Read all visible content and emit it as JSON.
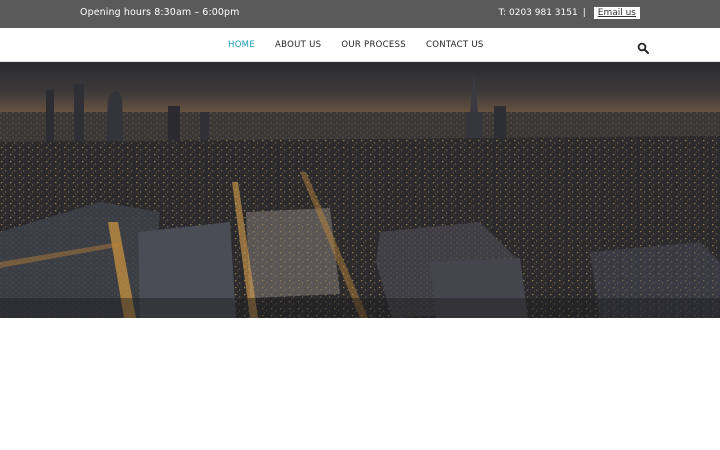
{
  "topbar": {
    "hours": "Opening hours 8:30am – 6:00pm",
    "phone": "T: 0203 981 3151",
    "separator": "|",
    "email_label": "Email us"
  },
  "nav": {
    "items": [
      {
        "label": "HOME",
        "active": true
      },
      {
        "label": "ABOUT US",
        "active": false
      },
      {
        "label": "OUR PROCESS",
        "active": false
      },
      {
        "label": "CONTACT US",
        "active": false
      }
    ],
    "search_icon": "search-icon"
  },
  "hero": {
    "image": "city-skyline-at-dusk"
  },
  "colors": {
    "topbar_bg": "#5a5a5a",
    "accent": "#1a9bb6",
    "nav_text": "#222222"
  }
}
